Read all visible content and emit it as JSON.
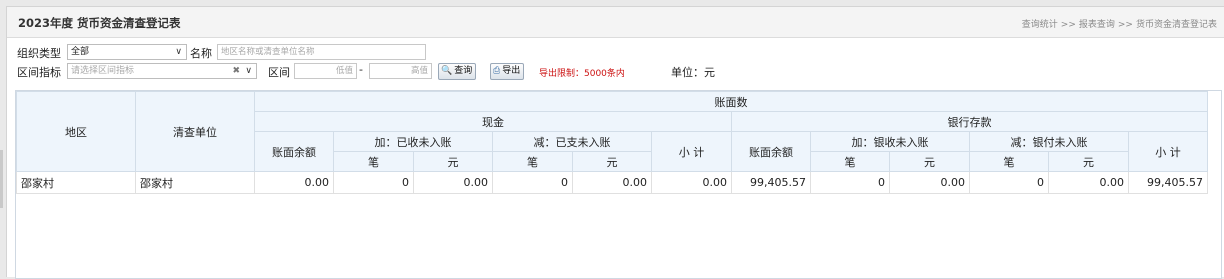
{
  "header": {
    "title": "2023年度 货币资金清查登记表",
    "breadcrumb": [
      "查询统计",
      "报表查询",
      "货币资金清查登记表"
    ],
    "breadcrumb_sep": ">>"
  },
  "filters": {
    "org_type_label": "组织类型",
    "org_type_value": "全部",
    "name_label": "名称",
    "name_placeholder": "地区名称或清查单位名称",
    "range_index_label": "区间指标",
    "range_index_placeholder": "请选择区间指标",
    "range_label": "区间",
    "range_low_placeholder": "低值",
    "range_dash": "-",
    "range_high_placeholder": "高值",
    "query_button": "查询",
    "export_button": "导出",
    "export_limit_note": "导出限制：5000条内",
    "unit_text": "单位：元"
  },
  "table": {
    "col_region": "地区",
    "col_unit": "清查单位",
    "group_book": "账面数",
    "group_cash": "现金",
    "group_bank": "银行存款",
    "cash_cols": {
      "balance": "账面余额",
      "add_group": "加：已收未入账",
      "sub_group": "减：已支未入账",
      "subtotal": "小 计"
    },
    "bank_cols": {
      "balance": "账面余额",
      "add_group": "加：银收未入账",
      "sub_group": "减：银付未入账",
      "subtotal": "小 计"
    },
    "count_label": "笔",
    "amount_label": "元",
    "rows": [
      {
        "region": "邵家村",
        "unit": "邵家村",
        "cash_balance": "0.00",
        "cash_add_count": "0",
        "cash_add_amount": "0.00",
        "cash_sub_count": "0",
        "cash_sub_amount": "0.00",
        "cash_subtotal": "0.00",
        "bank_balance": "99,405.57",
        "bank_add_count": "0",
        "bank_add_amount": "0.00",
        "bank_sub_count": "0",
        "bank_sub_amount": "0.00",
        "bank_subtotal": "99,405.57"
      }
    ]
  }
}
